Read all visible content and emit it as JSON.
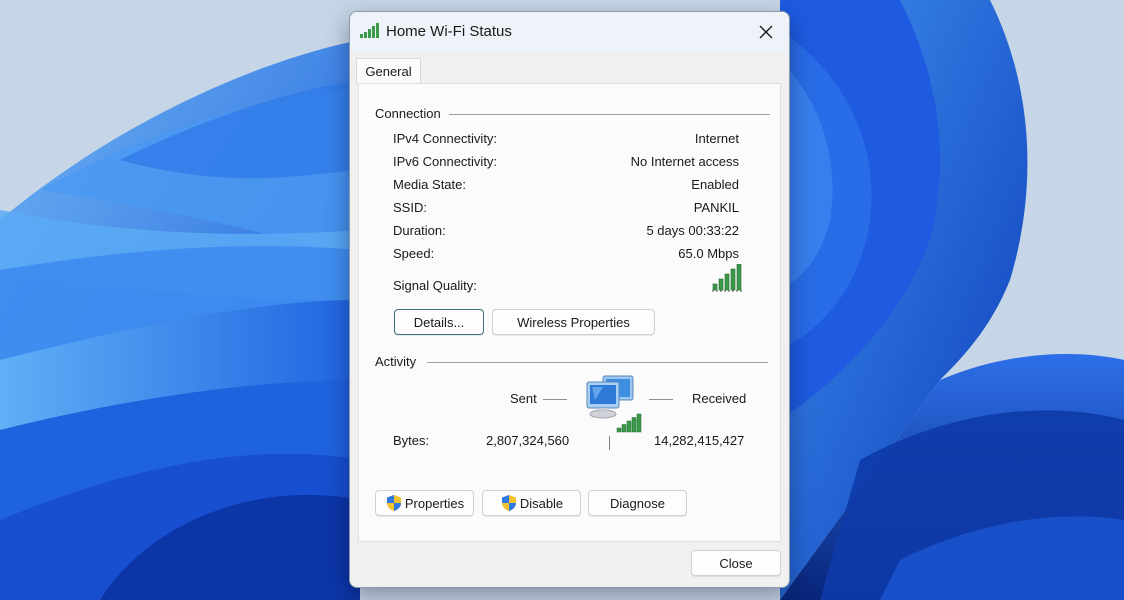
{
  "window": {
    "title": "Home Wi-Fi Status",
    "close_icon": "close-icon",
    "title_icon": "wifi-signal-icon"
  },
  "tabs": [
    {
      "label": "General",
      "selected": true
    }
  ],
  "connection": {
    "header": "Connection",
    "rows": [
      {
        "label": "IPv4 Connectivity:",
        "value": "Internet"
      },
      {
        "label": "IPv6 Connectivity:",
        "value": "No Internet access"
      },
      {
        "label": "Media State:",
        "value": "Enabled"
      },
      {
        "label": "SSID:",
        "value": "PANKIL"
      },
      {
        "label": "Duration:",
        "value": "5 days 00:33:22"
      },
      {
        "label": "Speed:",
        "value": "65.0 Mbps"
      }
    ],
    "signal_quality": {
      "label": "Signal Quality:",
      "bars": 5,
      "max_bars": 5,
      "icon": "signal-bars-icon"
    },
    "buttons": {
      "details": "Details...",
      "wireless_properties": "Wireless Properties"
    }
  },
  "activity": {
    "header": "Activity",
    "sent_label": "Sent",
    "received_label": "Received",
    "bytes_label": "Bytes:",
    "bytes_sent": "2,807,324,560",
    "bytes_received": "14,282,415,427",
    "icon": "network-computers-icon"
  },
  "action_buttons": {
    "properties": "Properties",
    "disable": "Disable",
    "diagnose": "Diagnose",
    "shield_icon": "uac-shield-icon"
  },
  "footer": {
    "close": "Close"
  },
  "colors": {
    "signal_green": "#3a9a4a",
    "default_button_border": "#3e6f7e",
    "wallpaper_blue": "#1e5fe0"
  }
}
